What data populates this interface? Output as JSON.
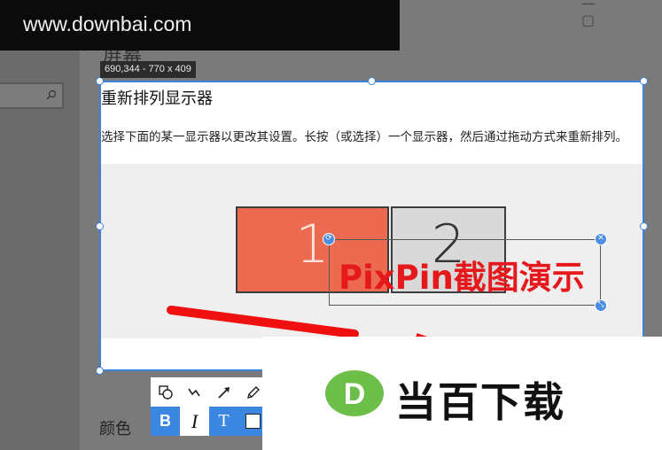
{
  "watermark": {
    "text": "www.downbai.com"
  },
  "background": {
    "heading": "屏幕",
    "color_label": "颜色",
    "window_controls": "— ▢"
  },
  "capture": {
    "size_tooltip": "690,344 - 770 x 409",
    "title": "重新排列显示器",
    "description": "选择下面的某一显示器以更改其设置。长按（或选择）一个显示器，然后通过拖动方式来重新排列。",
    "monitors": [
      {
        "label": "1",
        "color": "#ec6a50"
      },
      {
        "label": "2",
        "color": "#d9d9d9"
      }
    ]
  },
  "annotation": {
    "text": "PixPin截图演示",
    "color": "#e5181c"
  },
  "toolbar": {
    "row1": [
      "shapes-icon",
      "polyline-icon",
      "arrow-icon",
      "pencil-icon"
    ],
    "bold_label": "B",
    "italic_label": "I",
    "outline_label": "T"
  },
  "logo": {
    "mark_letter": "D",
    "text": "当百下载",
    "mark_color": "#6cc04a"
  },
  "colors": {
    "selection_border": "#3b82d9",
    "arrow_red": "#f01010"
  }
}
